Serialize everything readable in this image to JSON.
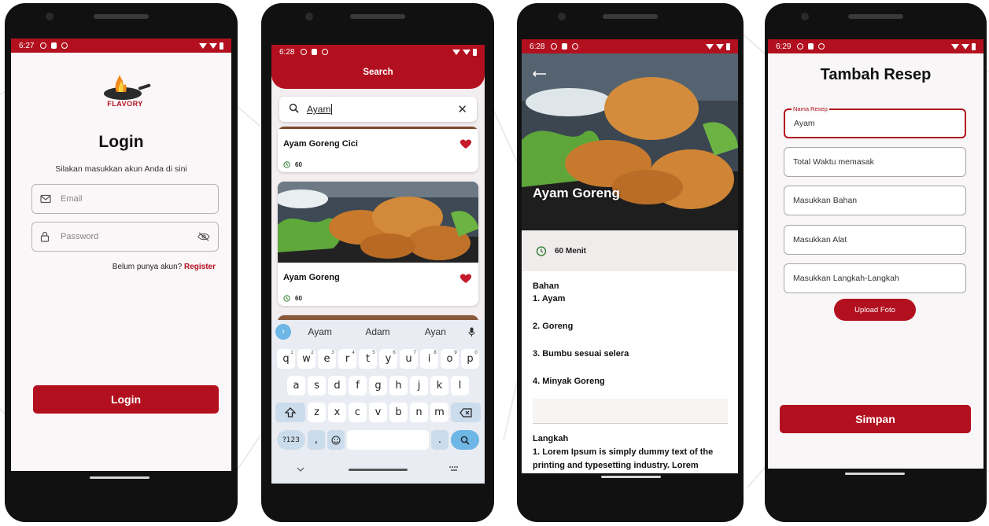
{
  "status": {
    "p1_time": "6:27",
    "p2_time": "6:28",
    "p3_time": "6:28",
    "p4_time": "6:29"
  },
  "login": {
    "logo_text": "FLAVORY",
    "title": "Login",
    "subtitle": "Silakan masukkan akun Anda di sini",
    "email_placeholder": "Email",
    "password_placeholder": "Password",
    "no_account": "Belum punya akun?",
    "register": "Register",
    "login_button": "Login",
    "icons": {
      "email": "mail-icon",
      "password": "lock-icon",
      "visibility": "eye-off-icon"
    }
  },
  "search": {
    "header": "Search",
    "query": "Ayam",
    "results": [
      {
        "name": "Ayam Goreng Cici",
        "time": "60"
      },
      {
        "name": "Ayam Goreng",
        "time": "60"
      }
    ],
    "keyboard": {
      "suggestions": [
        "Ayam",
        "Adam",
        "Ayan"
      ],
      "row1": [
        "q",
        "w",
        "e",
        "r",
        "t",
        "y",
        "u",
        "i",
        "o",
        "p"
      ],
      "row1_sup": [
        "1",
        "2",
        "3",
        "4",
        "5",
        "6",
        "7",
        "8",
        "9",
        "0"
      ],
      "row2": [
        "a",
        "s",
        "d",
        "f",
        "g",
        "h",
        "j",
        "k",
        "l"
      ],
      "row3": [
        "z",
        "x",
        "c",
        "v",
        "b",
        "n",
        "m"
      ],
      "num_key": "?123",
      "comma": ",",
      "period": "."
    }
  },
  "detail": {
    "title": "Ayam Goreng",
    "duration": "60 Menit",
    "ingredients_heading": "Bahan",
    "ingredients": [
      "1. Ayam",
      "2. Goreng",
      "3. Bumbu sesuai selera",
      "4. Minyak Goreng"
    ],
    "steps_heading": "Langkah",
    "steps_text": "1. Lorem Ipsum is simply dummy text of the printing and typesetting industry. Lorem"
  },
  "add_recipe": {
    "title": "Tambah Resep",
    "name_label": "Nama Resep",
    "name_value": "Ayam",
    "time_placeholder": "Total Waktu memasak",
    "ingredients_placeholder": "Masukkan Bahan",
    "tools_placeholder": "Masukkan Alat",
    "steps_placeholder": "Masukkan Langkah-Langkah",
    "upload_button": "Upload Foto",
    "save_button": "Simpan"
  },
  "colors": {
    "primary": "#b3101f",
    "screen_bg": "#fbf6f8"
  }
}
